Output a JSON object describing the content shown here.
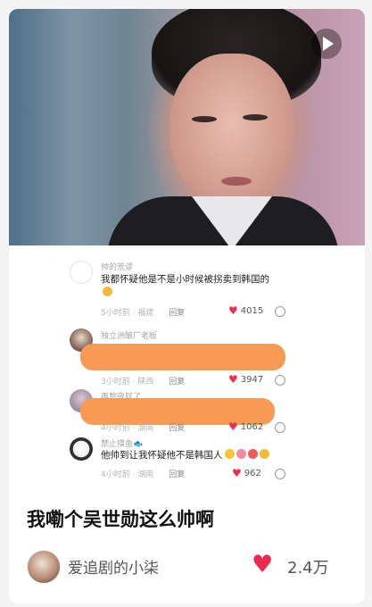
{
  "post": {
    "title": "我嘞个吴世勋这么帅啊",
    "author": "爱追剧的小柒",
    "likes": "2.4万",
    "media_type": "video"
  },
  "comments": [
    {
      "user": "帅的荒谬",
      "text": "我都怀疑他是不是小时候被拐卖到韩国的",
      "emoji": "laugh-emoji",
      "time": "5小时前",
      "location": "福建",
      "reply": "回复",
      "likes": "4015"
    },
    {
      "user": "独立洲酿厂老板",
      "time": "3小时前",
      "location": "陕西",
      "reply": "回复",
      "likes": "3947",
      "redacted": true
    },
    {
      "user": "再熬夜就了",
      "time": "4小时前",
      "location": "湖南",
      "reply": "回复",
      "likes": "1062",
      "redacted": true
    },
    {
      "user": "禁止摸鱼🐟",
      "text": "他帅到让我怀疑他不是韩国人",
      "emojis": [
        "smirk-emoji",
        "blush-emoji",
        "heart-eyes-emoji",
        "laugh-emoji"
      ],
      "time": "4小时前",
      "location": "湖南",
      "reply": "回复",
      "likes": "962"
    }
  ],
  "colors": {
    "accent": "#ec2a4d",
    "redaction": "#f79a55"
  }
}
